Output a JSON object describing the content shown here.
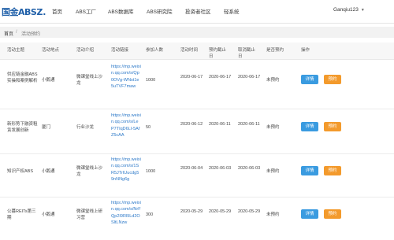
{
  "header": {
    "logo_text": "国金ABS",
    "logo_accent": "Z.",
    "nav": [
      "首页",
      "ABS工厂",
      "ABS数据库",
      "ABS研究院",
      "投资者社区",
      "轻系统"
    ],
    "user_name": "Ganqiu123"
  },
  "breadcrumb": {
    "home": "首页",
    "separator": "/",
    "current": "活动预约"
  },
  "table": {
    "columns": [
      "活动主题",
      "活动地点",
      "活动介绍",
      "活动链接",
      "参加人数",
      "活动时间",
      "预约截止日",
      "取消截止日",
      "是否预约",
      "操作"
    ],
    "rows": [
      {
        "theme": "供应链金融ABS实操和案例解析",
        "location": "小鹅通",
        "intro": "微课堂线上沙龙",
        "link": "https://mp.weixin.qq.com/s/Qp0OVg-WNst1e5uTVF7maw",
        "count": "1000",
        "time": "2020-06-17",
        "booking_deadline": "2020-06-17",
        "cancel_deadline": "2020-06-17",
        "status": "未预约",
        "detail_label": "详情",
        "book_label": "预约"
      },
      {
        "theme": "新形势下融资租赁发展创新",
        "location": "厦门",
        "intro": "行业沙龙",
        "link": "https://mp.weixin.qq.com/s/LeP7TIqD6LI-5AfZ5cAA",
        "count": "50",
        "time": "2020-06-12",
        "booking_deadline": "2020-06-11",
        "cancel_deadline": "2020-06-11",
        "status": "未预约",
        "detail_label": "详情",
        "book_label": "预约"
      },
      {
        "theme": "知识产权ABS",
        "location": "小鹅通",
        "intro": "微课堂线上沙龙",
        "link": "https://mp.weixin.qq.com/s/1SR5JTrIUucdg59nNNg6g",
        "count": "1000",
        "time": "2020-06-04",
        "booking_deadline": "2020-06-03",
        "cancel_deadline": "2020-06-03",
        "status": "未预约",
        "detail_label": "详情",
        "book_label": "预约"
      },
      {
        "theme": "公募REITs第三期",
        "location": "小鹅通",
        "intro": "微课堂线上研习营",
        "link": "https://mp.weixin.qq.com/s/NrFQp2I9Rl9Ld2OSltLNzw",
        "count": "300",
        "time": "2020-05-29",
        "booking_deadline": "2020-05-29",
        "cancel_deadline": "2020-05-29",
        "status": "未预约",
        "detail_label": "详情",
        "book_label": "预约"
      }
    ]
  },
  "colors": {
    "brand": "#1f5fa8",
    "accent": "#e54d2e",
    "link": "#2b78c8",
    "detail_button": "#3a9be0",
    "book_button": "#f39a2c"
  }
}
